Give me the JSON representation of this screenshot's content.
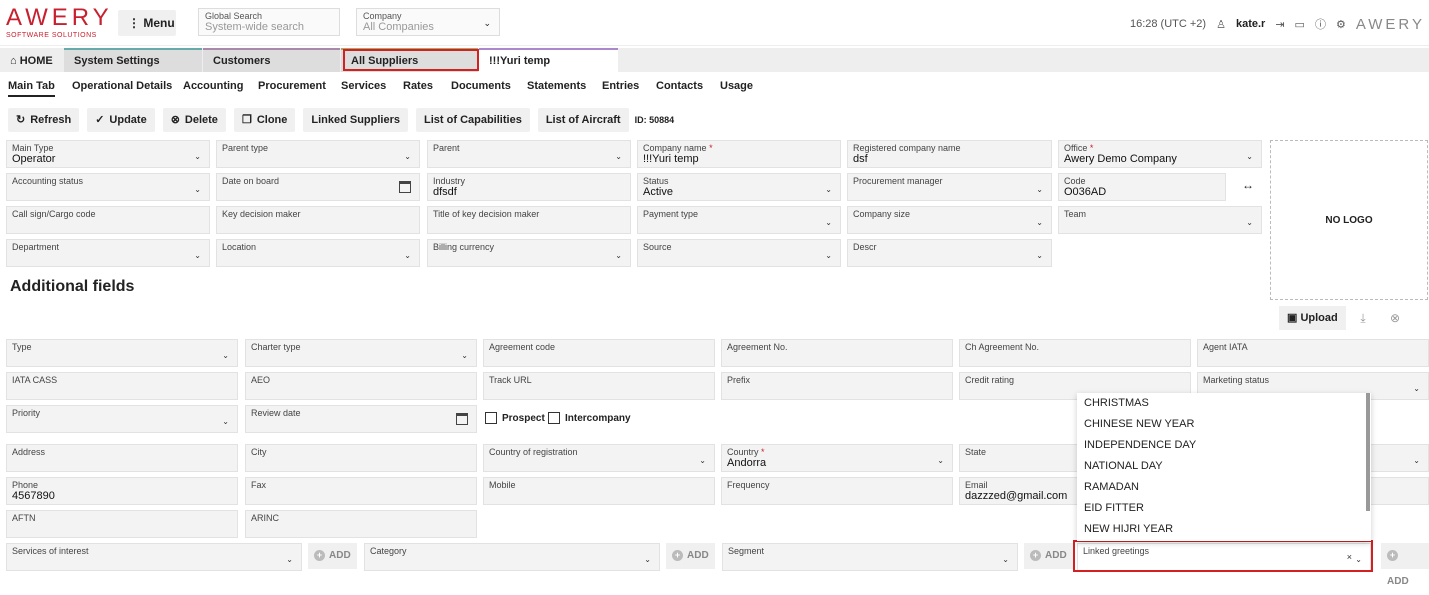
{
  "brand": {
    "logo_main": "AWERY",
    "logo_sub": "SOFTWARE SOLUTIONS",
    "right_logo": "AWERY"
  },
  "header": {
    "menu_label": "Menu",
    "search_label": "Global Search",
    "search_placeholder": "System-wide search",
    "company_label": "Company",
    "company_value": "All Companies",
    "time": "16:28 (UTC +2)",
    "user": "kate.r"
  },
  "tabs": [
    {
      "label": "HOME"
    },
    {
      "label": "System Settings"
    },
    {
      "label": "Customers"
    },
    {
      "label": "All Suppliers"
    },
    {
      "label": "!!!Yuri temp"
    }
  ],
  "subtabs": [
    "Main Tab",
    "Operational Details",
    "Accounting",
    "Procurement",
    "Services",
    "Rates",
    "Documents",
    "Statements",
    "Entries",
    "Contacts",
    "Usage"
  ],
  "actions": {
    "refresh": "Refresh",
    "update": "Update",
    "delete": "Delete",
    "clone": "Clone",
    "linked": "Linked Suppliers",
    "caps": "List of Capabilities",
    "aircraft": "List of Aircraft",
    "id": "ID: 50884"
  },
  "main_fields": {
    "main_type": {
      "label": "Main Type",
      "value": "Operator"
    },
    "parent_type": {
      "label": "Parent type",
      "value": ""
    },
    "parent": {
      "label": "Parent",
      "value": ""
    },
    "company_name": {
      "label": "Company name",
      "value": "!!!Yuri temp"
    },
    "reg_name": {
      "label": "Registered company name",
      "value": "dsf"
    },
    "office": {
      "label": "Office",
      "value": "Awery Demo Company"
    },
    "acc_status": {
      "label": "Accounting status",
      "value": ""
    },
    "date_board": {
      "label": "Date on board",
      "value": ""
    },
    "industry": {
      "label": "Industry",
      "value": "dfsdf"
    },
    "status": {
      "label": "Status",
      "value": "Active"
    },
    "proc_manager": {
      "label": "Procurement manager",
      "value": ""
    },
    "code": {
      "label": "Code",
      "value": "O036AD"
    },
    "call_sign": {
      "label": "Call sign/Cargo code",
      "value": ""
    },
    "key_maker": {
      "label": "Key decision maker",
      "value": ""
    },
    "title_maker": {
      "label": "Title of key decision maker",
      "value": ""
    },
    "payment_type": {
      "label": "Payment type",
      "value": ""
    },
    "company_size": {
      "label": "Company size",
      "value": ""
    },
    "team": {
      "label": "Team",
      "value": ""
    },
    "department": {
      "label": "Department",
      "value": ""
    },
    "location": {
      "label": "Location",
      "value": ""
    },
    "billing_currency": {
      "label": "Billing currency",
      "value": ""
    },
    "source": {
      "label": "Source",
      "value": ""
    },
    "descr": {
      "label": "Descr",
      "value": ""
    }
  },
  "no_logo": "NO LOGO",
  "upload": "Upload",
  "additional_title": "Additional fields",
  "add_fields": {
    "type": "Type",
    "charter": "Charter type",
    "agr_code": "Agreement code",
    "agr_no": "Agreement No.",
    "ch_agr": "Ch Agreement No.",
    "agent_iata": "Agent IATA",
    "iata_cass": "IATA CASS",
    "aeo": "AEO",
    "track": "Track URL",
    "prefix": "Prefix",
    "credit": "Credit rating",
    "marketing": "Marketing status",
    "priority": "Priority",
    "review": "Review date",
    "prospect": "Prospect",
    "intercompany": "Intercompany",
    "address": "Address",
    "city": "City",
    "country_reg": "Country of registration",
    "country": "Country",
    "country_value": "Andorra",
    "state": "State",
    "phone": "Phone",
    "phone_value": "4567890",
    "fax": "Fax",
    "mobile": "Mobile",
    "frequency": "Frequency",
    "email": "Email",
    "email_value": "dazzzed@gmail.com",
    "aftn": "AFTN",
    "arinc": "ARINC",
    "services": "Services of interest",
    "category": "Category",
    "segment": "Segment",
    "greetings": "Linked greetings",
    "add": "ADD"
  },
  "greetings_options": [
    "CHRISTMAS",
    "CHINESE NEW YEAR",
    "INDEPENDENCE DAY",
    "NATIONAL DAY",
    "RAMADAN",
    "EID FITTER",
    "NEW HIJRI YEAR"
  ]
}
